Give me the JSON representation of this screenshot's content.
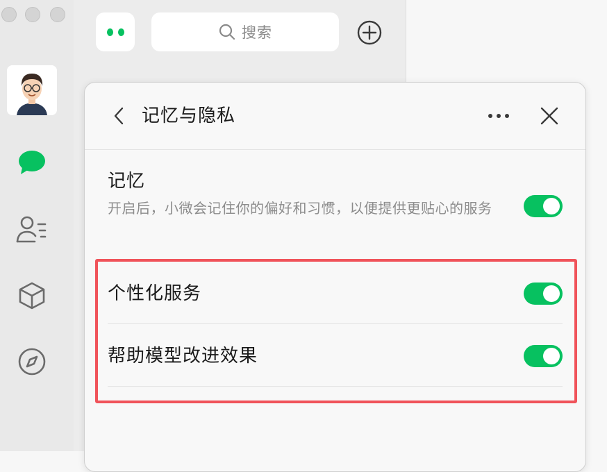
{
  "search": {
    "placeholder": "搜索"
  },
  "panel": {
    "title": "记忆与隐私",
    "memory": {
      "label": "记忆",
      "description": "开启后，小微会记住你的偏好和习惯，以便提供更贴心的服务",
      "enabled": true
    },
    "settings": [
      {
        "label": "个性化服务",
        "enabled": true
      },
      {
        "label": "帮助模型改进效果",
        "enabled": true
      }
    ]
  },
  "colors": {
    "accent": "#07c160",
    "highlight": "#f0535a"
  }
}
